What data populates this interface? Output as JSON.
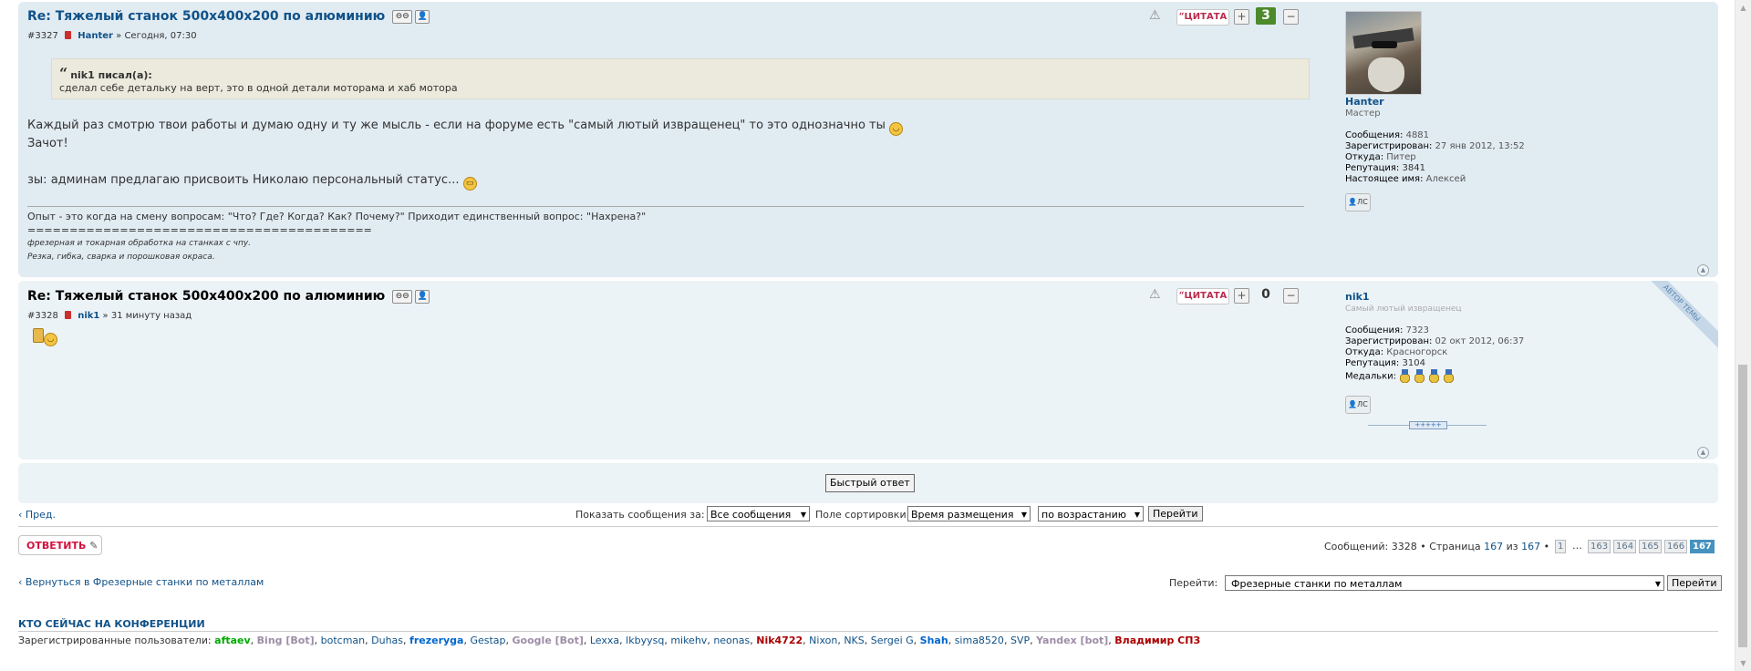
{
  "colors": {
    "link": "#105289",
    "bot": "#9e8da7",
    "admin": "#aa0000",
    "green_group": "#00aa00",
    "moderator": "#0066cc",
    "post_bg1": "#e1ebf2",
    "post_bg2": "#ecf3f7",
    "quote": "#bc2a4d",
    "reply": "#d31141"
  },
  "post1": {
    "title": "Re: Тяжелый станок 500x400x200 по алюминию",
    "num": "#3327",
    "author": "Hanter",
    "sep": "»",
    "time": "Сегодня, 07:30",
    "quote_label": "ЦИТАТА",
    "rep_value": "3",
    "quote": {
      "cite": "nik1 писал(а):",
      "text": "сделал себе детальку на верт, это в одной детали моторама и хаб мотора"
    },
    "line1": "Каждый раз смотрю твои работы и думаю одну и ту же мысль - если на форуме есть \"самый лютый извращенец\" то это однозначно ты",
    "line2": "Зачот!",
    "line3": "зы: админам предлагаю присвоить Николаю персональный статус...",
    "sig": {
      "line1": "Опыт - это когда на смену вопросам: \"Что? Где? Когда? Как? Почему?\" Приходит единственный вопрос: \"Нахрена?\"",
      "line2": "=========================================",
      "line3": "фрезерная и токарная обработка на станках с чпу.",
      "line4": "Резка, гибка, сварка и порошковая окраса."
    },
    "profile": {
      "username": "Hanter",
      "rank": "Мастер",
      "posts_label": "Сообщения:",
      "posts": "4881",
      "reg_label": "Зарегистрирован:",
      "reg": "27 янв 2012, 13:52",
      "from_label": "Откуда:",
      "from": "Питер",
      "rep_label": "Репутация:",
      "rep": "3841",
      "realname_label": "Настоящее имя:",
      "realname": "Алексей",
      "pm": "ЛС"
    }
  },
  "post2": {
    "title": "Re: Тяжелый станок 500x400x200 по алюминию",
    "num": "#3328",
    "author": "nik1",
    "sep": "»",
    "time": "31 минуту назад",
    "quote_label": "ЦИТАТА",
    "rep_value": "0",
    "profile": {
      "username": "nik1",
      "rank": "Самый лютый извращенец",
      "author_badge": "АВТОР ТЕМЫ",
      "posts_label": "Сообщения:",
      "posts": "7323",
      "reg_label": "Зарегистрирован:",
      "reg": "02 окт 2012, 06:37",
      "from_label": "Откуда:",
      "from": "Красногорск",
      "rep_label": "Репутация:",
      "rep": "3104",
      "medals_label": "Медальки:",
      "pm": "ЛС",
      "stars": "+++++"
    }
  },
  "quick_reply": "Быстрый ответ",
  "nav": {
    "prev": "Пред.",
    "show_label": "Показать сообщения за:",
    "show_value": "Все сообщения",
    "sort_label": "Поле сортировки",
    "sort_value": "Время размещения",
    "order_value": "по возрастанию",
    "go": "Перейти"
  },
  "reply_button": "ОТВЕТИТЬ",
  "pagination": {
    "summary": "Сообщений: 3328 • Страница",
    "current": "167",
    "of": "из",
    "total": "167",
    "bullet": "•",
    "first": "1",
    "dots": "…",
    "pages": [
      "163",
      "164",
      "165",
      "166",
      "167"
    ]
  },
  "back_link": "Вернуться в Фрезерные станки по металлам",
  "jump": {
    "label": "Перейти:",
    "value": "Фрезерные станки по металлам",
    "go": "Перейти"
  },
  "online": {
    "title": "КТО СЕЙЧАС НА КОНФЕРЕНЦИИ",
    "label": "Зарегистрированные пользователи:",
    "users": [
      {
        "name": "aftaev",
        "kind": "green"
      },
      {
        "name": "Bing [Bot]",
        "kind": "bot"
      },
      {
        "name": "botcman",
        "kind": "normal"
      },
      {
        "name": "Duhas",
        "kind": "normal"
      },
      {
        "name": "frezeryga",
        "kind": "mod"
      },
      {
        "name": "Gestap",
        "kind": "normal"
      },
      {
        "name": "Google [Bot]",
        "kind": "bot"
      },
      {
        "name": "Lexxa",
        "kind": "normal"
      },
      {
        "name": "lkbyysq",
        "kind": "normal"
      },
      {
        "name": "mikehv",
        "kind": "normal"
      },
      {
        "name": "neonas",
        "kind": "normal"
      },
      {
        "name": "Nik4722",
        "kind": "admin"
      },
      {
        "name": "Nixon",
        "kind": "normal"
      },
      {
        "name": "NKS",
        "kind": "normal"
      },
      {
        "name": "Sergei G",
        "kind": "normal"
      },
      {
        "name": "Shah",
        "kind": "mod"
      },
      {
        "name": "sima8520",
        "kind": "normal"
      },
      {
        "name": "SVP",
        "kind": "normal"
      },
      {
        "name": "Yandex [bot]",
        "kind": "bot"
      },
      {
        "name": "Владимир СПЗ",
        "kind": "admin"
      }
    ]
  }
}
